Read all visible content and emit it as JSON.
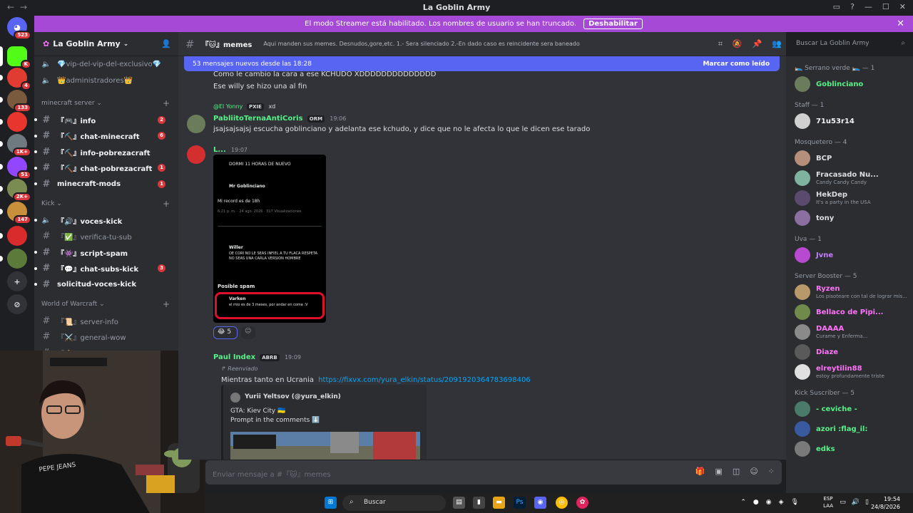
{
  "window": {
    "title": "La Goblin Army"
  },
  "banner": {
    "text": "El modo Streamer está habilitado. Los nombres de usuario se han truncado.",
    "button": "Deshabilitar"
  },
  "servers": [
    {
      "label": "523",
      "color": "#5865f2"
    },
    {
      "label": "K",
      "color": "#53fc18"
    },
    {
      "label": "4",
      "color": "#e03c31"
    },
    {
      "label": "133",
      "color": "#7a5a3c"
    },
    {
      "label": "",
      "color": "#e8352e"
    },
    {
      "label": "1K+",
      "color": "#6f7a80"
    },
    {
      "label": "51",
      "color": "#9146ff"
    },
    {
      "label": "2K+",
      "color": "#7b8c52"
    },
    {
      "label": "147",
      "color": "#c8903a"
    },
    {
      "label": "",
      "color": "#d92b2b"
    },
    {
      "label": "",
      "color": "#5c7a3a"
    }
  ],
  "sidebar": {
    "server_name": "La Goblin Army",
    "channels_top": [
      {
        "name": "💎vip-del-vip-del-exclusivo💎"
      },
      {
        "name": "👑administradores👑"
      }
    ],
    "categories": [
      {
        "name": "minecraft server",
        "channels": [
          {
            "name": "『🎮』info",
            "badge": "2",
            "unread": true
          },
          {
            "name": "『⛏️』chat-minecraft",
            "badge": "6",
            "unread": true
          },
          {
            "name": "『⛏️』info-pobrezacraft",
            "badge": "",
            "unread": true
          },
          {
            "name": "『⛏️』chat-pobrezacraft",
            "badge": "1",
            "unread": true
          },
          {
            "name": "minecraft-mods",
            "badge": "1",
            "unread": true
          }
        ]
      },
      {
        "name": "Kick",
        "channels": [
          {
            "name": "『🔊』voces-kick",
            "badge": "",
            "unread": true
          },
          {
            "name": "『✅』verifica-tu-sub",
            "badge": "",
            "unread": false
          },
          {
            "name": "『👾』script-spam",
            "badge": "",
            "unread": true
          },
          {
            "name": "『💬』chat-subs-kick",
            "badge": "3",
            "unread": true
          },
          {
            "name": "solicitud-voces-kick",
            "badge": "",
            "unread": true
          }
        ]
      },
      {
        "name": "World of Warcraft",
        "channels": [
          {
            "name": "『📜』server-info",
            "badge": "",
            "unread": false
          },
          {
            "name": "『⚔️』general-wow",
            "badge": "",
            "unread": false
          },
          {
            "name": "『📦』auto-rol-wow",
            "badge": "",
            "unread": false
          }
        ]
      }
    ]
  },
  "channel": {
    "name": "『🐱』memes",
    "topic": "Aqui manden sus memes. Desnudos,gore,etc. 1.- Sera silenciado 2.-En dado caso es reincidente sera baneado",
    "search_placeholder": "Buscar La Goblin Army"
  },
  "new_messages": {
    "text": "53 mensajes nuevos desde las 18:28",
    "action": "Marcar como leído"
  },
  "messages": {
    "m0": {
      "line1": "Como le cambio la cara a ese KCHUDO XDDDDDDDDDDDDDD",
      "line2": "Ese willy se hizo una al fin"
    },
    "m1": {
      "reply_user": "@El Yonny",
      "reply_tag": "PXIE",
      "reply_text": "xd",
      "user": "PabliitoTernaAntiCoris",
      "tag": "ORM",
      "time": "19:06",
      "text": "jsajsajsajsj escucha goblinciano y adelanta ese kchudo, y dice que no le afecta lo que le dicen ese tarado"
    },
    "m2": {
      "user": "L...",
      "time": "19:07",
      "reaction_count": "5"
    },
    "tweet": {
      "t1": "DORMI 11 HORAS DE NUEVO",
      "t2": "Mr Goblinciano",
      "t3": "Mi record es de 18h",
      "t4": "6:21 p. m. · 24 ago. 2026 · 317 Visualizaciones",
      "t5": "Willer",
      "t6": "OE CORI NO LE SEAS INFIEL A TU FLACA RESPETA NO SEAS UNA CARLA VERSION HOMBRE",
      "t7": "Posible spam",
      "t8": "Varken",
      "t9": "el mio es de 3 meses, por andar en coma :V"
    },
    "m3": {
      "user": "Paul Index",
      "tag": "ABRB",
      "time": "19:09",
      "forwarded": "Reenviado",
      "text": "Mientras tanto en Ucrania",
      "link": "https://fixvx.com/yura_elkin/status/2091920364783698406",
      "embed_author": "Yurii Yeltsov (@yura_elkin)",
      "embed_l1": "GTA: Kiev City 🇺🇦",
      "embed_l2": "Prompt in the comments ⬇️"
    }
  },
  "composer": {
    "placeholder": "Enviar mensaje a #『🐱』memes"
  },
  "members": [
    {
      "type": "cat",
      "label": "🛌 Serrano verde 🛌 — 1"
    },
    {
      "type": "mem",
      "name": "Goblinciano",
      "status": "",
      "color": "#57f287",
      "av": "#6b7c5a"
    },
    {
      "type": "cat",
      "label": "Staff — 1"
    },
    {
      "type": "mem",
      "name": "71u53r14",
      "status": "",
      "color": "#f2f3f5",
      "av": "#d0d0d0"
    },
    {
      "type": "cat",
      "label": "Mosquetero — 4"
    },
    {
      "type": "mem",
      "name": "BCP",
      "status": "",
      "color": "#dbdee1",
      "av": "#b58f7a"
    },
    {
      "type": "mem",
      "name": "Fracasado Nu...",
      "status": "Candy Candy Candy",
      "color": "#dbdee1",
      "av": "#7fb3a0"
    },
    {
      "type": "mem",
      "name": "HekDep",
      "status": "It's a party in the USA",
      "color": "#dbdee1",
      "av": "#5a4a6e"
    },
    {
      "type": "mem",
      "name": "tony",
      "status": "",
      "color": "#dbdee1",
      "av": "#8a6fa0"
    },
    {
      "type": "cat",
      "label": "Uva — 1"
    },
    {
      "type": "mem",
      "name": "Jvne",
      "status": "",
      "color": "#c77dff",
      "av": "#b84ad1"
    },
    {
      "type": "cat",
      "label": "Server Booster — 5"
    },
    {
      "type": "mem",
      "name": "Ryzen",
      "status": "Los pisoteare con tal de lograr mis...",
      "color": "#ff73fa",
      "av": "#b89a6a"
    },
    {
      "type": "mem",
      "name": "Bellaco de Pipi...",
      "status": "",
      "color": "#ff73fa",
      "av": "#6f8a4a"
    },
    {
      "type": "mem",
      "name": "DAAAA",
      "status": "Curame y Enferma...",
      "color": "#ff73fa",
      "av": "#8a8a8a"
    },
    {
      "type": "mem",
      "name": "Diaze",
      "status": "",
      "color": "#ff73fa",
      "av": "#5a5a5a"
    },
    {
      "type": "mem",
      "name": "elreytilin88",
      "status": "estoy profundamente triste",
      "color": "#ff73fa",
      "av": "#e0e0e0"
    },
    {
      "type": "cat",
      "label": "Kick Suscriber — 5"
    },
    {
      "type": "mem",
      "name": "- ceviche -",
      "status": "",
      "color": "#57f287",
      "av": "#4a7a6a"
    },
    {
      "type": "mem",
      "name": "azori :flag_il:",
      "status": "",
      "color": "#57f287",
      "av": "#3a5aa0"
    },
    {
      "type": "mem",
      "name": "edks",
      "status": "",
      "color": "#57f287",
      "av": "#7a7a7a"
    }
  ],
  "taskbar": {
    "search": "Buscar",
    "lang1": "ESP",
    "lang2": "LAA",
    "time": "19:54",
    "date": "24/8/2026"
  }
}
